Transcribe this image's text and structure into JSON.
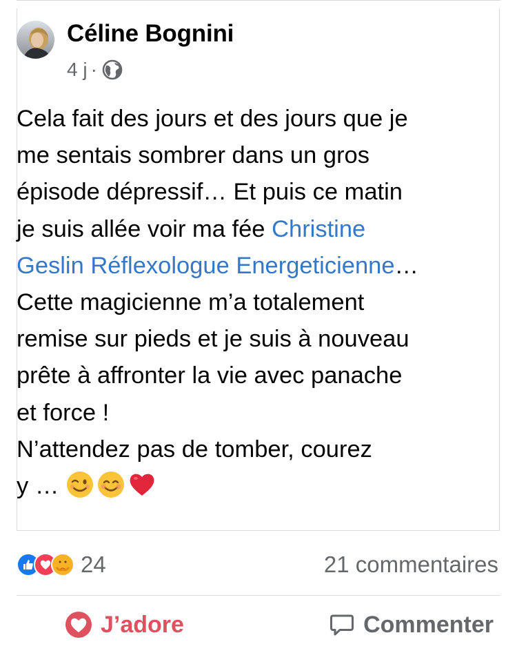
{
  "post": {
    "author": "Céline Bognini",
    "age": "4 j",
    "separator": "·",
    "privacy_icon": "globe-icon",
    "text_lines": [
      "Cela fait des jours et des jours que je",
      "me sentais sombrer dans un gros",
      "épisode dépressif… Et puis ce matin",
      "je suis allée voir ma fée",
      "Geslin Réflexologue Energeticienne",
      "Cette magicienne m’a totalement",
      "remise sur pieds et je suis à nouveau",
      "prête à affronter la vie avec panache",
      "et force !",
      "N’attendez pas de tomber, courez",
      "y …"
    ],
    "mention_part1": "Christine",
    "mention_part2": "Geslin Réflexologue Energeticienne",
    "mention_suffix": "…",
    "line4_prefix": "je suis allée voir ma fée",
    "last_line_prefix": "y …",
    "emojis": [
      "winking-face-emoji",
      "smiling-face-emoji",
      "red-heart-emoji"
    ]
  },
  "stats": {
    "reaction_icons": [
      "like-reaction-icon",
      "love-reaction-icon",
      "care-reaction-icon"
    ],
    "reaction_count": "24",
    "comments": "21 commentaires"
  },
  "actions": {
    "love_label": "J’adore",
    "comment_label": "Commenter"
  },
  "colors": {
    "mention": "#3578c8",
    "love": "#e0515f",
    "secondary_text": "#65676b",
    "like_blue": "#1877f2"
  }
}
